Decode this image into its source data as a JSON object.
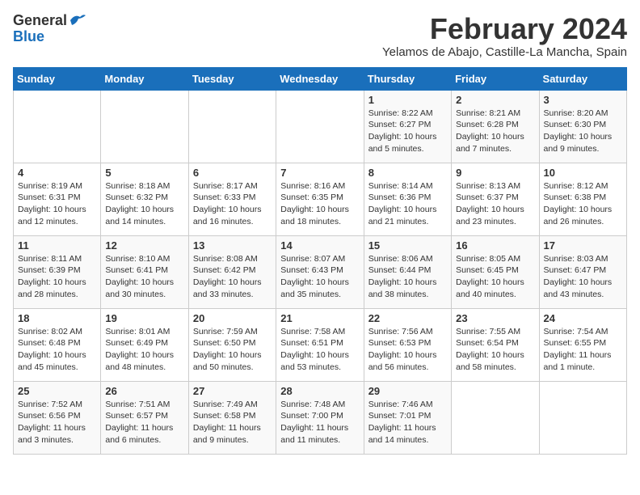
{
  "logo": {
    "general": "General",
    "blue": "Blue"
  },
  "title": "February 2024",
  "subtitle": "Yelamos de Abajo, Castille-La Mancha, Spain",
  "headers": [
    "Sunday",
    "Monday",
    "Tuesday",
    "Wednesday",
    "Thursday",
    "Friday",
    "Saturday"
  ],
  "weeks": [
    [
      {
        "day": "",
        "info": ""
      },
      {
        "day": "",
        "info": ""
      },
      {
        "day": "",
        "info": ""
      },
      {
        "day": "",
        "info": ""
      },
      {
        "day": "1",
        "info": "Sunrise: 8:22 AM\nSunset: 6:27 PM\nDaylight: 10 hours and 5 minutes."
      },
      {
        "day": "2",
        "info": "Sunrise: 8:21 AM\nSunset: 6:28 PM\nDaylight: 10 hours and 7 minutes."
      },
      {
        "day": "3",
        "info": "Sunrise: 8:20 AM\nSunset: 6:30 PM\nDaylight: 10 hours and 9 minutes."
      }
    ],
    [
      {
        "day": "4",
        "info": "Sunrise: 8:19 AM\nSunset: 6:31 PM\nDaylight: 10 hours and 12 minutes."
      },
      {
        "day": "5",
        "info": "Sunrise: 8:18 AM\nSunset: 6:32 PM\nDaylight: 10 hours and 14 minutes."
      },
      {
        "day": "6",
        "info": "Sunrise: 8:17 AM\nSunset: 6:33 PM\nDaylight: 10 hours and 16 minutes."
      },
      {
        "day": "7",
        "info": "Sunrise: 8:16 AM\nSunset: 6:35 PM\nDaylight: 10 hours and 18 minutes."
      },
      {
        "day": "8",
        "info": "Sunrise: 8:14 AM\nSunset: 6:36 PM\nDaylight: 10 hours and 21 minutes."
      },
      {
        "day": "9",
        "info": "Sunrise: 8:13 AM\nSunset: 6:37 PM\nDaylight: 10 hours and 23 minutes."
      },
      {
        "day": "10",
        "info": "Sunrise: 8:12 AM\nSunset: 6:38 PM\nDaylight: 10 hours and 26 minutes."
      }
    ],
    [
      {
        "day": "11",
        "info": "Sunrise: 8:11 AM\nSunset: 6:39 PM\nDaylight: 10 hours and 28 minutes."
      },
      {
        "day": "12",
        "info": "Sunrise: 8:10 AM\nSunset: 6:41 PM\nDaylight: 10 hours and 30 minutes."
      },
      {
        "day": "13",
        "info": "Sunrise: 8:08 AM\nSunset: 6:42 PM\nDaylight: 10 hours and 33 minutes."
      },
      {
        "day": "14",
        "info": "Sunrise: 8:07 AM\nSunset: 6:43 PM\nDaylight: 10 hours and 35 minutes."
      },
      {
        "day": "15",
        "info": "Sunrise: 8:06 AM\nSunset: 6:44 PM\nDaylight: 10 hours and 38 minutes."
      },
      {
        "day": "16",
        "info": "Sunrise: 8:05 AM\nSunset: 6:45 PM\nDaylight: 10 hours and 40 minutes."
      },
      {
        "day": "17",
        "info": "Sunrise: 8:03 AM\nSunset: 6:47 PM\nDaylight: 10 hours and 43 minutes."
      }
    ],
    [
      {
        "day": "18",
        "info": "Sunrise: 8:02 AM\nSunset: 6:48 PM\nDaylight: 10 hours and 45 minutes."
      },
      {
        "day": "19",
        "info": "Sunrise: 8:01 AM\nSunset: 6:49 PM\nDaylight: 10 hours and 48 minutes."
      },
      {
        "day": "20",
        "info": "Sunrise: 7:59 AM\nSunset: 6:50 PM\nDaylight: 10 hours and 50 minutes."
      },
      {
        "day": "21",
        "info": "Sunrise: 7:58 AM\nSunset: 6:51 PM\nDaylight: 10 hours and 53 minutes."
      },
      {
        "day": "22",
        "info": "Sunrise: 7:56 AM\nSunset: 6:53 PM\nDaylight: 10 hours and 56 minutes."
      },
      {
        "day": "23",
        "info": "Sunrise: 7:55 AM\nSunset: 6:54 PM\nDaylight: 10 hours and 58 minutes."
      },
      {
        "day": "24",
        "info": "Sunrise: 7:54 AM\nSunset: 6:55 PM\nDaylight: 11 hours and 1 minute."
      }
    ],
    [
      {
        "day": "25",
        "info": "Sunrise: 7:52 AM\nSunset: 6:56 PM\nDaylight: 11 hours and 3 minutes."
      },
      {
        "day": "26",
        "info": "Sunrise: 7:51 AM\nSunset: 6:57 PM\nDaylight: 11 hours and 6 minutes."
      },
      {
        "day": "27",
        "info": "Sunrise: 7:49 AM\nSunset: 6:58 PM\nDaylight: 11 hours and 9 minutes."
      },
      {
        "day": "28",
        "info": "Sunrise: 7:48 AM\nSunset: 7:00 PM\nDaylight: 11 hours and 11 minutes."
      },
      {
        "day": "29",
        "info": "Sunrise: 7:46 AM\nSunset: 7:01 PM\nDaylight: 11 hours and 14 minutes."
      },
      {
        "day": "",
        "info": ""
      },
      {
        "day": "",
        "info": ""
      }
    ]
  ]
}
